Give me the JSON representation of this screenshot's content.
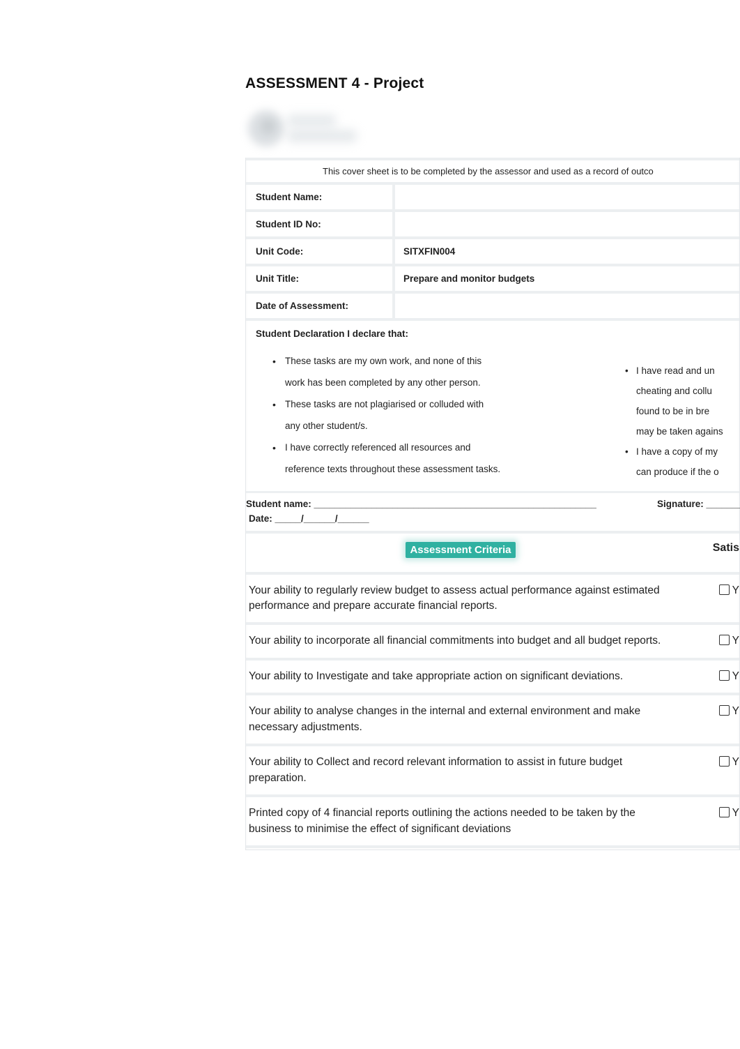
{
  "title": "ASSESSMENT 4 - Project",
  "cover_note": "This cover sheet is to be completed by the assessor and used as a record of outco",
  "fields": {
    "student_name_label": "Student Name:",
    "student_name_value": "",
    "student_id_label": "Student ID No:",
    "student_id_value": "",
    "unit_code_label": "Unit Code:",
    "unit_code_value": "SITXFIN004",
    "unit_title_label": "Unit Title:",
    "unit_title_value": "Prepare and monitor budgets",
    "date_assess_label": "Date of Assessment:",
    "date_assess_value": ""
  },
  "declaration": {
    "heading": "Student Declaration I declare that:",
    "left": [
      {
        "a": "These tasks are my own work, and none of this",
        "b": "work has been completed by any other person."
      },
      {
        "a": "These tasks are not plagiarised or colluded with",
        "b": "any other student/s."
      },
      {
        "a": "I have correctly referenced all resources and",
        "b": "reference texts throughout these assessment tasks."
      }
    ],
    "right": {
      "l1": "I have read and un",
      "l2": "cheating and collu",
      "l3": "found to be in bre",
      "l4": "may be taken agains",
      "l5": "I have a copy of my",
      "l6": "can produce if the o"
    }
  },
  "sig": {
    "name_label": "Student name: ______________________________________________________",
    "signature_label": "Signature: ________________",
    "date_label": "Date: _____/______/______"
  },
  "criteria_header": {
    "title": "Assessment Criteria",
    "sat": "Satis"
  },
  "criteria": [
    "Your ability to regularly review budget to assess actual performance against estimated performance and prepare accurate financial reports.",
    "Your ability to incorporate all financial commitments into budget and  all budget reports.",
    "Your ability to Investigate and take appropriate action on significant  deviations.",
    "Your ability to analyse changes in the internal and external  environment and make necessary adjustments.",
    "Your ability to Collect and record relevant information to assist in  future budget preparation.",
    "Printed copy of 4 financial reports outlining the actions needed to be  taken by the business to minimise the effect of significant deviations"
  ],
  "check_label": "Y"
}
